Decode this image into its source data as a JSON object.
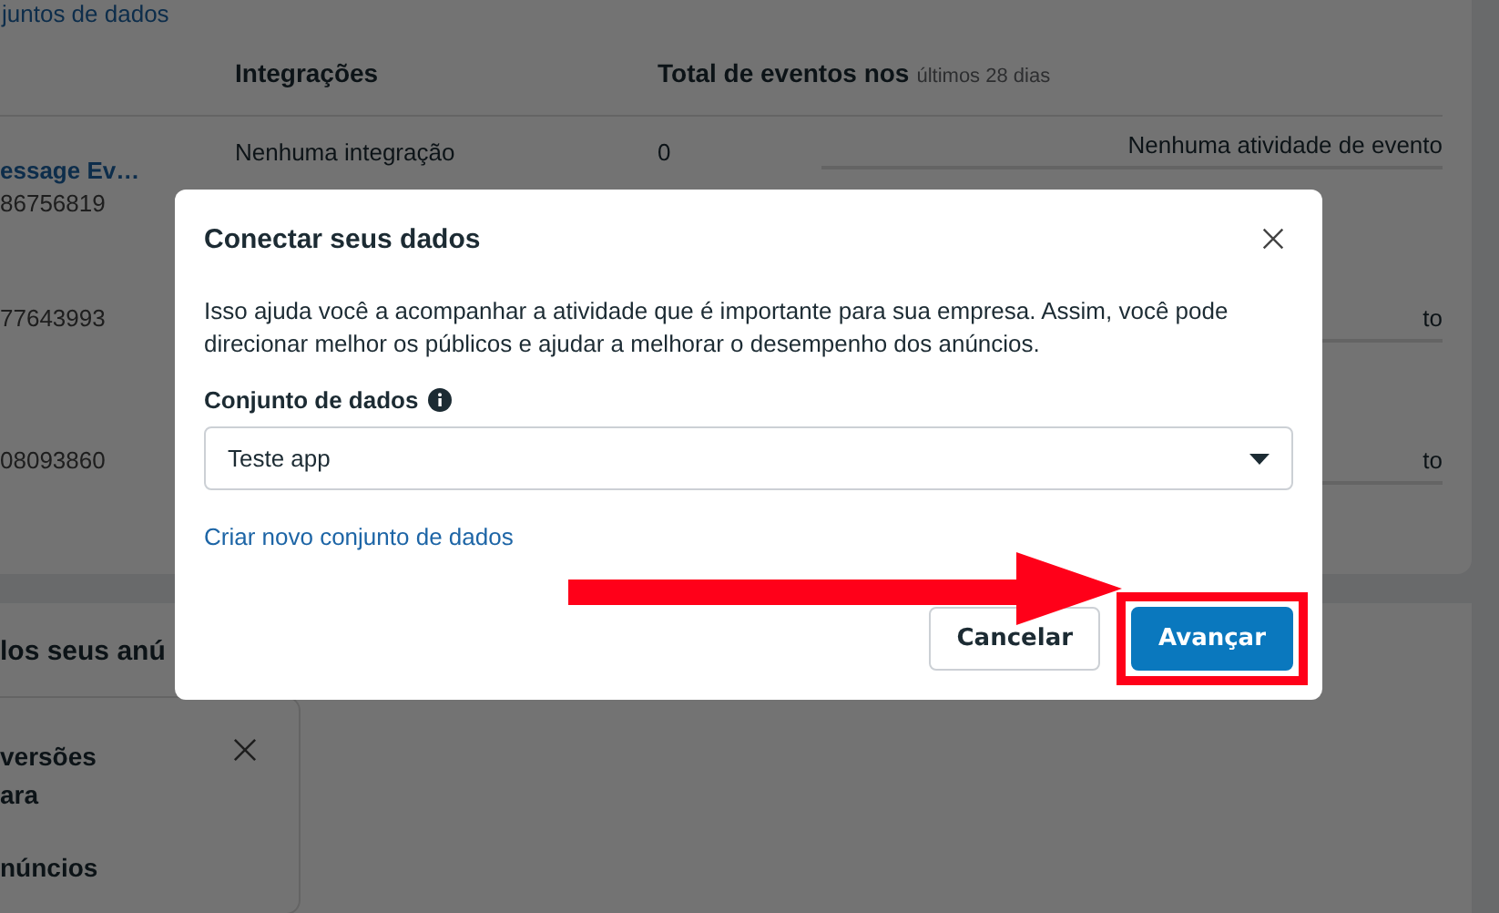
{
  "background": {
    "link": "juntos de dados",
    "columns": [
      {
        "label": "Integrações"
      },
      {
        "label": "Total de eventos nos",
        "suffix": "últimos 28 dias"
      }
    ],
    "rows": [
      {
        "name": "essage Ev…",
        "id": "86756819",
        "integration": "Nenhuma integração",
        "total": "0",
        "activity": "Nenhuma atividade de evento"
      },
      {
        "name": "",
        "id": "77643993",
        "integration": "",
        "total": "",
        "activity": "to"
      },
      {
        "name": "",
        "id": "08093860",
        "integration": "",
        "total": "",
        "activity": "to"
      }
    ],
    "section_title": "los seus anú",
    "tip": {
      "lines": [
        "versões",
        "ara"
      ],
      "footer": "núncios"
    }
  },
  "dialog": {
    "title": "Conectar seus dados",
    "description": "Isso ajuda você a acompanhar a atividade que é importante para sua empresa. Assim, você pode direcionar melhor os públicos e ajudar a melhorar o desempenho dos anúncios.",
    "field_label": "Conjunto de dados",
    "select_value": "Teste app",
    "link": "Criar novo conjunto de dados",
    "buttons": [
      {
        "label": "Cancelar",
        "kind": "secondary",
        "highlighted": false
      },
      {
        "label": "Avançar",
        "kind": "primary",
        "highlighted": true
      }
    ]
  }
}
